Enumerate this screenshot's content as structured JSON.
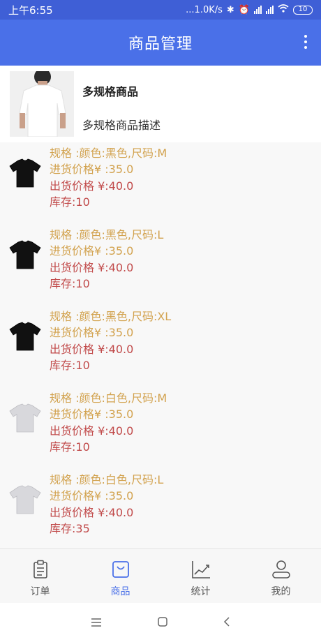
{
  "status": {
    "time": "上午6:55",
    "net_speed": "...1.0K/s",
    "battery": "10"
  },
  "app_bar": {
    "title": "商品管理"
  },
  "product": {
    "name": "多规格商品",
    "description": "多规格商品描述"
  },
  "variants": [
    {
      "spec": "规格 :颜色:黑色,尺码:M",
      "buy_price": "进货价格¥ :35.0",
      "sell_price": "出货价格 ¥:40.0",
      "stock": "库存:10",
      "shirt_color": "#111111"
    },
    {
      "spec": "规格 :颜色:黑色,尺码:L",
      "buy_price": "进货价格¥ :35.0",
      "sell_price": "出货价格 ¥:40.0",
      "stock": "库存:10",
      "shirt_color": "#111111"
    },
    {
      "spec": "规格 :颜色:黑色,尺码:XL",
      "buy_price": "进货价格¥ :35.0",
      "sell_price": "出货价格 ¥:40.0",
      "stock": "库存:10",
      "shirt_color": "#111111"
    },
    {
      "spec": "规格 :颜色:白色,尺码:M",
      "buy_price": "进货价格¥ :35.0",
      "sell_price": "出货价格 ¥:40.0",
      "stock": "库存:10",
      "shirt_color": "#d8d8dc"
    },
    {
      "spec": "规格 :颜色:白色,尺码:L",
      "buy_price": "进货价格¥ :35.0",
      "sell_price": "出货价格 ¥:40.0",
      "stock": "库存:35",
      "shirt_color": "#d8d8dc"
    }
  ],
  "tabs": [
    {
      "label": "订单",
      "icon": "clipboard-icon"
    },
    {
      "label": "商品",
      "icon": "shopping-bag-icon"
    },
    {
      "label": "统计",
      "icon": "chart-icon"
    },
    {
      "label": "我的",
      "icon": "user-icon"
    }
  ],
  "colors": {
    "primary": "#4a70e8",
    "status_bar": "#3f5fd6",
    "spec_text": "#d2a24e",
    "price_text": "#c14a4a"
  }
}
